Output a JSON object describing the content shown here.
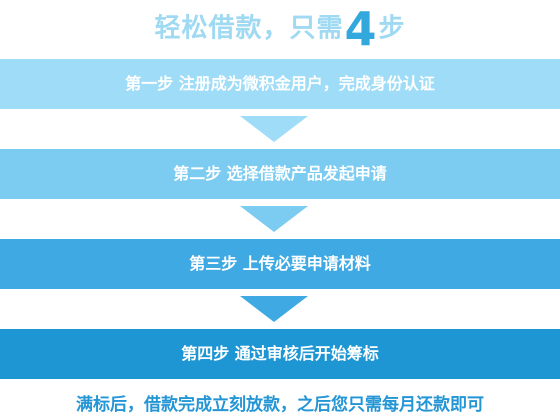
{
  "title": {
    "prefix": "轻松借款，只需",
    "number": "4",
    "suffix": "步"
  },
  "steps": [
    {
      "label": "第一步 注册成为微积金用户，完成身份认证"
    },
    {
      "label": "第二步 选择借款产品发起申请"
    },
    {
      "label": "第三步 上传必要申请材料"
    },
    {
      "label": "第四步 通过审核后开始筹标"
    }
  ],
  "footer": "满标后，借款完成立刻放款，之后您只需每月还款即可",
  "colors": {
    "title_light": "#9fd9f2",
    "title_number": "#33a8dd",
    "step1": "#9fdcf7",
    "step2": "#7ccbf0",
    "step3": "#3fa9e3",
    "step4": "#1e96d4",
    "footer_text": "#2596d5"
  }
}
